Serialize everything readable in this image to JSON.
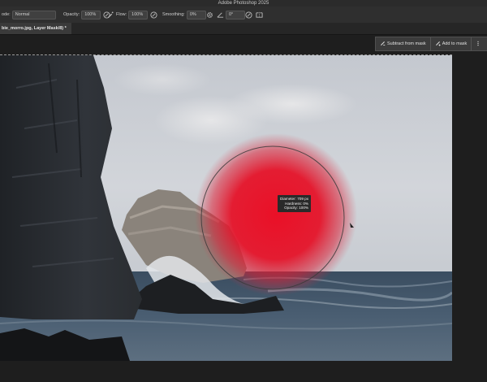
{
  "app": {
    "title": "Adobe Photoshop 2025"
  },
  "options_bar": {
    "mode_label": "ode:",
    "mode_value": "Normal",
    "opacity_label": "Opacity:",
    "opacity_value": "100%",
    "flow_label": "Flow:",
    "flow_value": "100%",
    "smoothing_label": "Smoothing:",
    "smoothing_value": "0%",
    "angle_value": "0°"
  },
  "document_tab": {
    "title": "bie_morro.jpg, Layer Mask/8) *"
  },
  "mask_bar": {
    "subtract_label": "Subtract from mask",
    "add_label": "Add to mask"
  },
  "brush_info": {
    "diameter_label": "Diameter:",
    "diameter_value": "709 px",
    "hardness_label": "Hardness:",
    "hardness_value": "0%",
    "opacity_label": "Opacity:",
    "opacity_value": "100%"
  },
  "colors": {
    "ui_dark": "#1e1e1e",
    "overlay_red": "#e8132b",
    "sky": "#c9cdd3",
    "sea": "#3f5366"
  },
  "icons": [
    "pressure-opacity-icon",
    "airbrush-icon",
    "pressure-flow-icon",
    "gear-icon",
    "angle-icon",
    "symmetry-icon",
    "pressure-size-icon",
    "brush-cursor-icon",
    "subtract-mask-icon",
    "add-mask-icon",
    "more-icon"
  ]
}
